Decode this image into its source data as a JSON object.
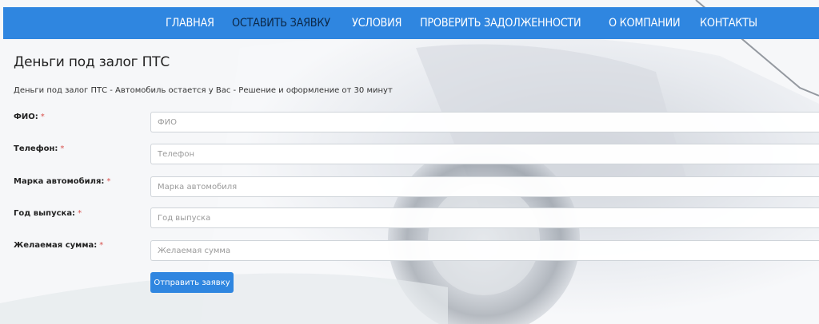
{
  "nav": {
    "items": [
      {
        "label": "Главная"
      },
      {
        "label": "Оставить заявку"
      },
      {
        "label": "Условия"
      },
      {
        "label": "Проверить задолженности"
      },
      {
        "label": "О компании"
      },
      {
        "label": "Контакты"
      }
    ],
    "active_index": 1
  },
  "page": {
    "title": "Деньги под залог ПТС",
    "subtitle": "Деньги под залог ПТС - Автомобиль остается у Вас - Решение и оформление от 30 минут"
  },
  "form": {
    "required_mark": "*",
    "fields": [
      {
        "label": "ФИО:",
        "placeholder": "ФИО",
        "value": ""
      },
      {
        "label": "Телефон:",
        "placeholder": "Телефон",
        "value": ""
      },
      {
        "label": "Марка автомобиля:",
        "placeholder": "Марка автомобиля",
        "value": ""
      },
      {
        "label": "Год выпуска:",
        "placeholder": "Год выпуска",
        "value": ""
      },
      {
        "label": "Желаемая сумма:",
        "placeholder": "Желаемая сумма",
        "value": ""
      }
    ],
    "submit_label": "Отправить заявку"
  },
  "colors": {
    "nav_bg": "#2f86e0",
    "nav_text": "#ffffff",
    "nav_active_text": "#0c2746",
    "button_bg": "#2f86e0",
    "required": "#d9534f"
  }
}
